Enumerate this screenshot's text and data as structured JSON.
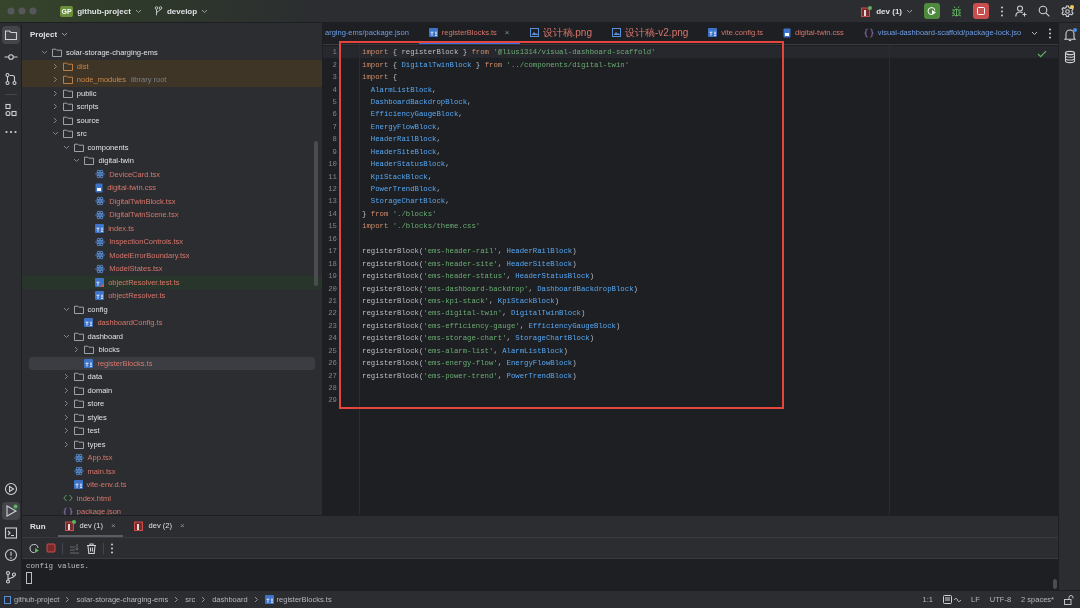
{
  "title_bar": {
    "project_badge": "GP",
    "project": "github-project",
    "branch": "develop",
    "run_config": "dev (1)",
    "run_config_running": true,
    "settings_alert": true
  },
  "left_toolbar": {
    "top": [
      {
        "kind": "project",
        "selected": true
      },
      {
        "kind": "commit",
        "selected": false
      },
      {
        "kind": "pull-requests",
        "selected": false
      },
      {
        "kind": "structure",
        "selected": false
      },
      {
        "kind": "more",
        "selected": false
      }
    ],
    "bottom": [
      {
        "kind": "services",
        "selected": false
      },
      {
        "kind": "run",
        "selected": true
      },
      {
        "kind": "terminal",
        "selected": false
      },
      {
        "kind": "problems",
        "selected": false
      },
      {
        "kind": "git",
        "selected": false
      }
    ]
  },
  "right_toolbar": [
    {
      "kind": "notifications",
      "alert": true
    },
    {
      "kind": "database",
      "alert": false
    }
  ],
  "project_panel": {
    "title": "Project",
    "tree": [
      {
        "label": "solar-storage-charging-ems",
        "kind": "folder",
        "excluded": false,
        "unversioned": false,
        "expanded": true,
        "selected": false,
        "children": [
          {
            "label": "dist",
            "kind": "folder",
            "excluded": true,
            "unversioned": false,
            "expanded": false,
            "selected": false
          },
          {
            "label": "node_modules",
            "hint": "library root",
            "kind": "folder",
            "excluded": true,
            "unversioned": false,
            "expanded": false,
            "selected": false
          },
          {
            "label": "public",
            "kind": "folder",
            "excluded": false,
            "unversioned": false,
            "expanded": false,
            "selected": false
          },
          {
            "label": "scripts",
            "kind": "folder",
            "excluded": false,
            "unversioned": false,
            "expanded": false,
            "selected": false
          },
          {
            "label": "source",
            "kind": "folder",
            "excluded": false,
            "unversioned": false,
            "expanded": false,
            "selected": false
          },
          {
            "label": "src",
            "kind": "folder",
            "excluded": false,
            "unversioned": false,
            "expanded": true,
            "selected": false,
            "children": [
              {
                "label": "components",
                "kind": "folder",
                "excluded": false,
                "unversioned": false,
                "expanded": true,
                "selected": false,
                "children": [
                  {
                    "label": "digital-twin",
                    "kind": "folder",
                    "excluded": false,
                    "unversioned": false,
                    "expanded": true,
                    "selected": false,
                    "children": [
                      {
                        "label": "DeviceCard.tsx",
                        "kind": "tsx",
                        "excluded": false,
                        "unversioned": true,
                        "selected": false
                      },
                      {
                        "label": "digital-twin.css",
                        "kind": "css",
                        "excluded": false,
                        "unversioned": true,
                        "selected": false
                      },
                      {
                        "label": "DigitalTwinBlock.tsx",
                        "kind": "tsx",
                        "excluded": false,
                        "unversioned": true,
                        "selected": false
                      },
                      {
                        "label": "DigitalTwinScene.tsx",
                        "kind": "tsx",
                        "excluded": false,
                        "unversioned": true,
                        "selected": false
                      },
                      {
                        "label": "index.ts",
                        "kind": "ts",
                        "excluded": false,
                        "unversioned": true,
                        "selected": false
                      },
                      {
                        "label": "InspectionControls.tsx",
                        "kind": "tsx",
                        "excluded": false,
                        "unversioned": true,
                        "selected": false
                      },
                      {
                        "label": "ModelErrorBoundary.tsx",
                        "kind": "tsx",
                        "excluded": false,
                        "unversioned": true,
                        "selected": false
                      },
                      {
                        "label": "ModelStates.tsx",
                        "kind": "tsx",
                        "excluded": false,
                        "unversioned": true,
                        "selected": false
                      },
                      {
                        "label": "objectResolver.test.ts",
                        "kind": "test-ts",
                        "excluded": false,
                        "unversioned": true,
                        "selected": false
                      },
                      {
                        "label": "objectResolver.ts",
                        "kind": "ts",
                        "excluded": false,
                        "unversioned": true,
                        "selected": false
                      }
                    ]
                  }
                ]
              },
              {
                "label": "config",
                "kind": "folder",
                "excluded": false,
                "unversioned": false,
                "expanded": true,
                "selected": false,
                "children": [
                  {
                    "label": "dashboardConfig.ts",
                    "kind": "ts",
                    "excluded": false,
                    "unversioned": true,
                    "selected": false
                  }
                ]
              },
              {
                "label": "dashboard",
                "kind": "folder",
                "excluded": false,
                "unversioned": false,
                "expanded": true,
                "selected": false,
                "children": [
                  {
                    "label": "blocks",
                    "kind": "folder",
                    "excluded": false,
                    "unversioned": false,
                    "expanded": false,
                    "selected": false
                  },
                  {
                    "label": "registerBlocks.ts",
                    "kind": "ts",
                    "excluded": false,
                    "unversioned": true,
                    "selected": true
                  }
                ]
              },
              {
                "label": "data",
                "kind": "folder",
                "excluded": false,
                "unversioned": false,
                "expanded": false,
                "selected": false
              },
              {
                "label": "domain",
                "kind": "folder",
                "excluded": false,
                "unversioned": false,
                "expanded": false,
                "selected": false
              },
              {
                "label": "store",
                "kind": "folder",
                "excluded": false,
                "unversioned": false,
                "expanded": false,
                "selected": false
              },
              {
                "label": "styles",
                "kind": "folder",
                "excluded": false,
                "unversioned": false,
                "expanded": false,
                "selected": false
              },
              {
                "label": "test",
                "kind": "folder",
                "excluded": false,
                "unversioned": false,
                "expanded": false,
                "selected": false
              },
              {
                "label": "types",
                "kind": "folder",
                "excluded": false,
                "unversioned": false,
                "expanded": false,
                "selected": false
              },
              {
                "label": "App.tsx",
                "kind": "tsx",
                "excluded": false,
                "unversioned": true,
                "selected": false
              },
              {
                "label": "main.tsx",
                "kind": "tsx",
                "excluded": false,
                "unversioned": true,
                "selected": false
              },
              {
                "label": "vite-env.d.ts",
                "kind": "ts",
                "excluded": false,
                "unversioned": true,
                "selected": false
              }
            ]
          },
          {
            "label": "index.html",
            "kind": "html",
            "excluded": false,
            "unversioned": true,
            "selected": false
          },
          {
            "label": "package.json",
            "kind": "json",
            "excluded": false,
            "unversioned": true,
            "selected": false
          }
        ]
      }
    ]
  },
  "editor": {
    "tabs": [
      {
        "label": "arging-ems/package.json",
        "kind": "none",
        "unversioned": false,
        "selected": false
      },
      {
        "label": "registerBlocks.ts",
        "kind": "ts",
        "unversioned": true,
        "selected": true,
        "close": "×"
      },
      {
        "label": "设计稿.png",
        "kind": "png",
        "unversioned": true,
        "selected": false
      },
      {
        "label": "设计稿-v2.png",
        "kind": "png",
        "unversioned": true,
        "selected": false
      },
      {
        "label": "vite.config.ts",
        "kind": "ts",
        "unversioned": true,
        "selected": false
      },
      {
        "label": "digital-twin.css",
        "kind": "css",
        "unversioned": true,
        "selected": false
      },
      {
        "label": "visual-dashboard-scaffold/package-lock.jso",
        "kind": "json",
        "unversioned": false,
        "selected": false
      }
    ],
    "lines": [
      {
        "number": "1",
        "current": true,
        "tokens": [
          {
            "kind": "keyword",
            "text": "import"
          },
          {
            "kind": "plain",
            "text": " { registerBlock } "
          },
          {
            "kind": "keyword",
            "text": "from"
          },
          {
            "kind": "string",
            "text": " '@lius1314/visual-dashboard-scaffold'"
          }
        ]
      },
      {
        "number": "2",
        "current": false,
        "tokens": [
          {
            "kind": "keyword",
            "text": "import"
          },
          {
            "kind": "plain",
            "text": " { "
          },
          {
            "kind": "name",
            "text": "DigitalTwinBlock"
          },
          {
            "kind": "plain",
            "text": " } "
          },
          {
            "kind": "keyword",
            "text": "from"
          },
          {
            "kind": "string",
            "text": " '../components/digital-twin'"
          }
        ]
      },
      {
        "number": "3",
        "current": false,
        "tokens": [
          {
            "kind": "keyword",
            "text": "import"
          },
          {
            "kind": "plain",
            "text": " {"
          }
        ]
      },
      {
        "number": "4",
        "current": false,
        "tokens": [
          {
            "kind": "name",
            "text": "  AlarmListBlock"
          },
          {
            "kind": "plain",
            "text": ","
          }
        ]
      },
      {
        "number": "5",
        "current": false,
        "tokens": [
          {
            "kind": "name",
            "text": "  DashboardBackdropBlock"
          },
          {
            "kind": "plain",
            "text": ","
          }
        ]
      },
      {
        "number": "6",
        "current": false,
        "tokens": [
          {
            "kind": "name",
            "text": "  EfficiencyGaugeBlock"
          },
          {
            "kind": "plain",
            "text": ","
          }
        ]
      },
      {
        "number": "7",
        "current": false,
        "tokens": [
          {
            "kind": "name",
            "text": "  EnergyFlowBlock"
          },
          {
            "kind": "plain",
            "text": ","
          }
        ]
      },
      {
        "number": "8",
        "current": false,
        "tokens": [
          {
            "kind": "name",
            "text": "  HeaderRailBlock"
          },
          {
            "kind": "plain",
            "text": ","
          }
        ]
      },
      {
        "number": "9",
        "current": false,
        "tokens": [
          {
            "kind": "name",
            "text": "  HeaderSiteBlock"
          },
          {
            "kind": "plain",
            "text": ","
          }
        ]
      },
      {
        "number": "10",
        "current": false,
        "tokens": [
          {
            "kind": "name",
            "text": "  HeaderStatusBlock"
          },
          {
            "kind": "plain",
            "text": ","
          }
        ]
      },
      {
        "number": "11",
        "current": false,
        "tokens": [
          {
            "kind": "name",
            "text": "  KpiStackBlock"
          },
          {
            "kind": "plain",
            "text": ","
          }
        ]
      },
      {
        "number": "12",
        "current": false,
        "tokens": [
          {
            "kind": "name",
            "text": "  PowerTrendBlock"
          },
          {
            "kind": "plain",
            "text": ","
          }
        ]
      },
      {
        "number": "13",
        "current": false,
        "tokens": [
          {
            "kind": "name",
            "text": "  StorageChartBlock"
          },
          {
            "kind": "plain",
            "text": ","
          }
        ]
      },
      {
        "number": "14",
        "current": false,
        "tokens": [
          {
            "kind": "plain",
            "text": "} "
          },
          {
            "kind": "keyword",
            "text": "from"
          },
          {
            "kind": "string",
            "text": " './blocks'"
          }
        ]
      },
      {
        "number": "15",
        "current": false,
        "tokens": [
          {
            "kind": "keyword",
            "text": "import"
          },
          {
            "kind": "string",
            "text": " './blocks/theme.css'"
          }
        ]
      },
      {
        "number": "16",
        "current": false
      },
      {
        "number": "17",
        "current": false,
        "tokens": [
          {
            "kind": "plain",
            "text": "registerBlock("
          },
          {
            "kind": "string",
            "text": "'ems-header-rail'"
          },
          {
            "kind": "plain",
            "text": ","
          },
          {
            "kind": "name",
            "text": " HeaderRailBlock"
          },
          {
            "kind": "plain",
            "text": ")"
          }
        ]
      },
      {
        "number": "18",
        "current": false,
        "tokens": [
          {
            "kind": "plain",
            "text": "registerBlock("
          },
          {
            "kind": "string",
            "text": "'ems-header-site'"
          },
          {
            "kind": "plain",
            "text": ","
          },
          {
            "kind": "name",
            "text": " HeaderSiteBlock"
          },
          {
            "kind": "plain",
            "text": ")"
          }
        ]
      },
      {
        "number": "19",
        "current": false,
        "tokens": [
          {
            "kind": "plain",
            "text": "registerBlock("
          },
          {
            "kind": "string",
            "text": "'ems-header-status'"
          },
          {
            "kind": "plain",
            "text": ","
          },
          {
            "kind": "name",
            "text": " HeaderStatusBlock"
          },
          {
            "kind": "plain",
            "text": ")"
          }
        ]
      },
      {
        "number": "20",
        "current": false,
        "tokens": [
          {
            "kind": "plain",
            "text": "registerBlock("
          },
          {
            "kind": "string",
            "text": "'ems-dashboard-backdrop'"
          },
          {
            "kind": "plain",
            "text": ","
          },
          {
            "kind": "name",
            "text": " DashboardBackdropBlock"
          },
          {
            "kind": "plain",
            "text": ")"
          }
        ]
      },
      {
        "number": "21",
        "current": false,
        "tokens": [
          {
            "kind": "plain",
            "text": "registerBlock("
          },
          {
            "kind": "string",
            "text": "'ems-kpi-stack'"
          },
          {
            "kind": "plain",
            "text": ","
          },
          {
            "kind": "name",
            "text": " KpiStackBlock"
          },
          {
            "kind": "plain",
            "text": ")"
          }
        ]
      },
      {
        "number": "22",
        "current": false,
        "tokens": [
          {
            "kind": "plain",
            "text": "registerBlock("
          },
          {
            "kind": "string",
            "text": "'ems-digital-twin'"
          },
          {
            "kind": "plain",
            "text": ","
          },
          {
            "kind": "name",
            "text": " DigitalTwinBlock"
          },
          {
            "kind": "plain",
            "text": ")"
          }
        ]
      },
      {
        "number": "23",
        "current": false,
        "tokens": [
          {
            "kind": "plain",
            "text": "registerBlock("
          },
          {
            "kind": "string",
            "text": "'ems-efficiency-gauge'"
          },
          {
            "kind": "plain",
            "text": ","
          },
          {
            "kind": "name",
            "text": " EfficiencyGaugeBlock"
          },
          {
            "kind": "plain",
            "text": ")"
          }
        ]
      },
      {
        "number": "24",
        "current": false,
        "tokens": [
          {
            "kind": "plain",
            "text": "registerBlock("
          },
          {
            "kind": "string",
            "text": "'ems-storage-chart'"
          },
          {
            "kind": "plain",
            "text": ","
          },
          {
            "kind": "name",
            "text": " StorageChartBlock"
          },
          {
            "kind": "plain",
            "text": ")"
          }
        ]
      },
      {
        "number": "25",
        "current": false,
        "tokens": [
          {
            "kind": "plain",
            "text": "registerBlock("
          },
          {
            "kind": "string",
            "text": "'ems-alarm-list'"
          },
          {
            "kind": "plain",
            "text": ","
          },
          {
            "kind": "name",
            "text": " AlarmListBlock"
          },
          {
            "kind": "plain",
            "text": ")"
          }
        ]
      },
      {
        "number": "26",
        "current": false,
        "tokens": [
          {
            "kind": "plain",
            "text": "registerBlock("
          },
          {
            "kind": "string",
            "text": "'ems-energy-flow'"
          },
          {
            "kind": "plain",
            "text": ","
          },
          {
            "kind": "name",
            "text": " EnergyFlowBlock"
          },
          {
            "kind": "plain",
            "text": ")"
          }
        ]
      },
      {
        "number": "27",
        "current": false,
        "tokens": [
          {
            "kind": "plain",
            "text": "registerBlock("
          },
          {
            "kind": "string",
            "text": "'ems-power-trend'"
          },
          {
            "kind": "plain",
            "text": ","
          },
          {
            "kind": "name",
            "text": " PowerTrendBlock"
          },
          {
            "kind": "plain",
            "text": ")"
          }
        ]
      },
      {
        "number": "28",
        "current": false
      },
      {
        "number": "29",
        "current": false
      }
    ]
  },
  "run_panel": {
    "title": "Run",
    "tabs": [
      {
        "label": "dev (1)",
        "running": true,
        "selected": true,
        "close": "×"
      },
      {
        "label": "dev (2)",
        "running": false,
        "selected": false,
        "close": "×"
      }
    ],
    "output": [
      "config values."
    ]
  },
  "status_bar": {
    "breadcrumbs": [
      {
        "label": "github-project",
        "kind": "project"
      },
      {
        "label": "solar-storage-charging-ems",
        "kind": "folder"
      },
      {
        "label": "src",
        "kind": "folder"
      },
      {
        "label": "dashboard",
        "kind": "folder"
      },
      {
        "label": "registerBlocks.ts",
        "kind": "ts"
      }
    ],
    "position": "1:1",
    "line_ending": "LF",
    "encoding": "UTF-8",
    "indent": "2 spaces*"
  }
}
